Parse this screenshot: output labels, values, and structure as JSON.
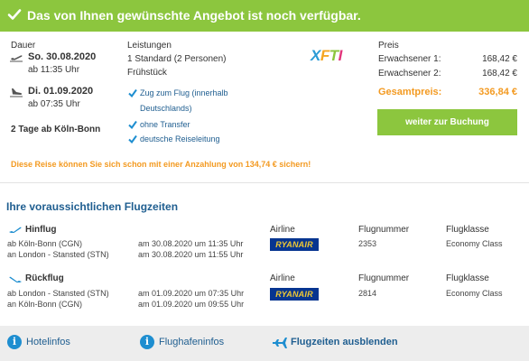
{
  "banner": {
    "text": "Das von Ihnen gewünschte Angebot ist noch verfügbar."
  },
  "dauer": {
    "label": "Dauer",
    "outbound_date": "So. 30.08.2020",
    "outbound_time": "ab 11:35 Uhr",
    "return_date": "Di. 01.09.2020",
    "return_time": "ab 07:35 Uhr",
    "summary": "2 Tage ab Köln-Bonn"
  },
  "leistungen": {
    "label": "Leistungen",
    "room": "1 Standard (2 Personen)",
    "board": "Frühstück",
    "features": [
      {
        "line1": "Zug zum Flug (innerhalb",
        "line2": "Deutschlands)"
      },
      {
        "line1": "ohne Transfer"
      },
      {
        "line1": "deutsche Reiseleitung"
      }
    ],
    "logo_text": "XFTI"
  },
  "preis": {
    "label": "Preis",
    "rows": [
      {
        "name": "Erwachsener 1:",
        "value": "168,42 €"
      },
      {
        "name": "Erwachsener 2:",
        "value": "168,42 €"
      }
    ],
    "total_label": "Gesamtpreis:",
    "total_value": "336,84 €",
    "button": "weiter zur Buchung"
  },
  "deposit_note": "Diese Reise können Sie sich schon mit einer Anzahlung von 134,74 € sichern!",
  "flights": {
    "title": "Ihre voraussichtlichen Flugzeiten",
    "headers": {
      "airline": "Airline",
      "number": "Flugnummer",
      "class": "Flugklasse"
    },
    "legs": [
      {
        "label": "Hinflug",
        "from": "ab Köln-Bonn (CGN)",
        "to": "an London - Stansted (STN)",
        "dep": "am 30.08.2020 um 11:35 Uhr",
        "arr": "am 30.08.2020 um 11:55 Uhr",
        "airline": "RYANAIR",
        "number": "2353",
        "class": "Economy Class"
      },
      {
        "label": "Rückflug",
        "from": "ab London - Stansted (STN)",
        "to": "an Köln-Bonn (CGN)",
        "dep": "am 01.09.2020 um 07:35 Uhr",
        "arr": "am 01.09.2020 um 09:55 Uhr",
        "airline": "RYANAIR",
        "number": "2814",
        "class": "Economy Class"
      }
    ]
  },
  "footer": {
    "hotel": "Hotelinfos",
    "airport": "Flughafeninfos",
    "hide": "Flugzeiten ausblenden"
  },
  "colors": {
    "green": "#8cc63e",
    "blue": "#1f5e90",
    "orange": "#f39a21",
    "icon_blue": "#1e8ed0"
  }
}
